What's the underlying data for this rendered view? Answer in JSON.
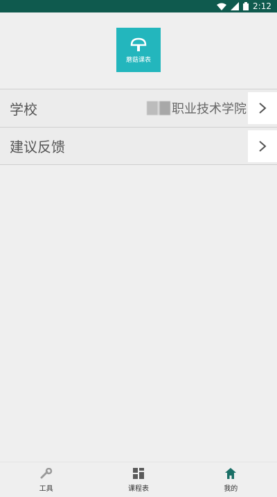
{
  "status_bar": {
    "time": "2:12"
  },
  "logo": {
    "text": "蘑菇课表"
  },
  "settings": [
    {
      "label": "学校",
      "value_visible": "职业技术学院"
    },
    {
      "label": "建议反馈"
    }
  ],
  "tabs": [
    {
      "label": "工具",
      "icon": "wrench-icon",
      "color": "#9a9a9a"
    },
    {
      "label": "课程表",
      "icon": "grid-icon",
      "color": "#5a5a5a"
    },
    {
      "label": "我的",
      "icon": "home-icon",
      "color": "#1a6f66"
    }
  ],
  "colors": {
    "status_bar": "#0f5a4e",
    "logo_bg": "#23b6bd",
    "active_tab": "#1a6f66"
  }
}
